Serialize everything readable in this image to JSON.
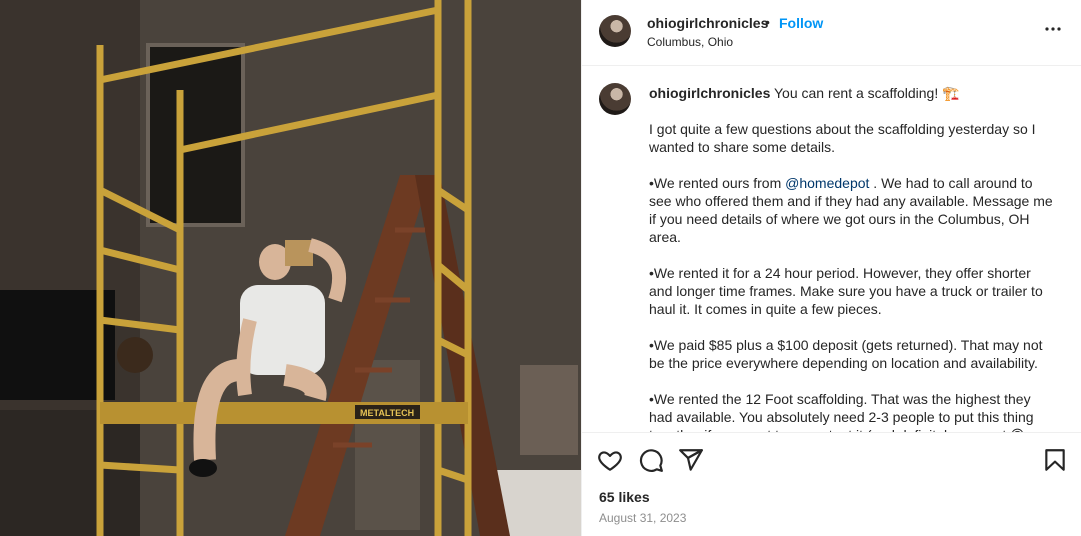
{
  "post": {
    "username": "ohiogirlchronicles",
    "dot": "•",
    "follow_label": "Follow",
    "location": "Columbus, Ohio",
    "caption": {
      "username": "ohiogirlchronicles",
      "headline": " You can rent a scaffolding! 🏗️",
      "p1": "I got quite a few questions about the scaffolding yesterday so I wanted to share some details.",
      "p2_before": "•We rented ours from ",
      "p2_mention": "@homedepot",
      "p2_after": " . We had to call around to see who offered them and if they had any available. Message me if you need details of where we got ours in the Columbus, OH area.",
      "p3": "•We rented it for a 24 hour period. However, they offer shorter and longer time frames. Make sure you have a truck or trailer to haul it. It comes in quite a few pieces.",
      "p4": "•We paid $85 plus a $100 deposit (gets returned). That may not be the price everywhere depending on location and availability.",
      "p5": "•We rented the 12 Foot scaffolding. That was the highest they had available. You absolutely need 2-3 people to put this thing together if you want to use a tent it (and definitely was not 🙃"
    },
    "likes": "65 likes",
    "date": "August 31, 2023",
    "photo_brand_text": "METALTECH"
  },
  "icons": {
    "more": "more-options-icon",
    "like": "heart-icon",
    "comment": "comment-icon",
    "share": "share-icon",
    "save": "bookmark-icon"
  },
  "colors": {
    "accent": "#0095f6",
    "text": "#262626",
    "muted": "#8e8e8e",
    "mention": "#00376b",
    "scaffold": "#c9a23a"
  }
}
